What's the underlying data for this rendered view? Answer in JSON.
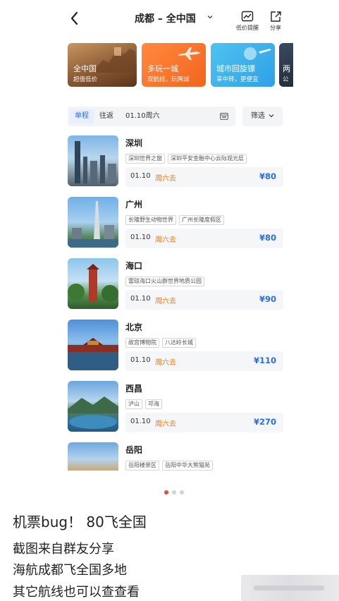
{
  "header": {
    "route": "成都 – 全中国",
    "price_alert_label": "低价提醒",
    "share_label": "分享"
  },
  "cards": [
    {
      "title": "全中国",
      "subtitle": "超值低价"
    },
    {
      "title": "多玩一城",
      "subtitle": "双航线，玩两城"
    },
    {
      "title": "城市回旋镖",
      "subtitle": "享中转，更便宜"
    },
    {
      "title": "两",
      "subtitle": "公"
    }
  ],
  "tabs": {
    "oneway": "单程",
    "roundtrip": "往返",
    "date": "01.10周六",
    "filter": "筛选"
  },
  "flights": [
    {
      "city": "深圳",
      "tags": [
        "深圳世界之窗",
        "深圳平安金融中心云际观光层"
      ],
      "date": "01.10",
      "dow": "周六去",
      "price": "¥80"
    },
    {
      "city": "广州",
      "tags": [
        "长隆野生动物世界",
        "广州长隆度假区"
      ],
      "date": "01.10",
      "dow": "周六去",
      "price": "¥80"
    },
    {
      "city": "海口",
      "tags": [
        "雷琼海口火山群世界地质公园"
      ],
      "date": "01.10",
      "dow": "周六去",
      "price": "¥90"
    },
    {
      "city": "北京",
      "tags": [
        "故宫博物院",
        "八达岭长城"
      ],
      "date": "01.10",
      "dow": "周六去",
      "price": "¥110"
    },
    {
      "city": "西昌",
      "tags": [
        "泸山",
        "邛海"
      ],
      "date": "01.10",
      "dow": "周六去",
      "price": "¥270"
    },
    {
      "city": "岳阳",
      "tags": [
        "岳阳楼景区",
        "岳阳中华大熊猫苑"
      ]
    }
  ],
  "caption": {
    "title": "机票bug！ 80飞全国",
    "line1": "截图来自群友分享",
    "line2": "海航成都飞全国多地",
    "line3": "其它航线也可以查查看"
  },
  "colors": {
    "accent": "#2a6fe8",
    "orange": "#f07a1a"
  }
}
